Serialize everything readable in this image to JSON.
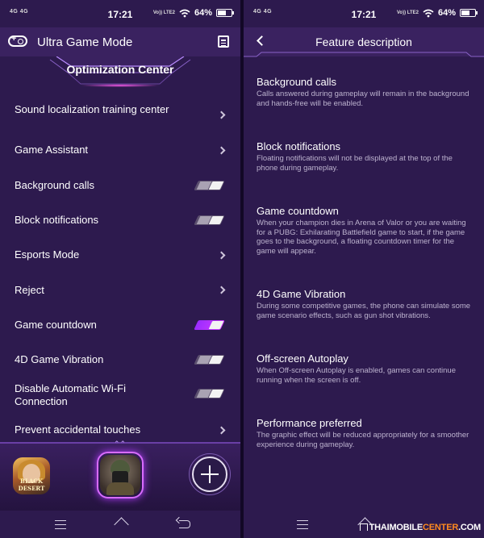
{
  "status_bar": {
    "signal": "4G 4G",
    "time": "17:21",
    "volte": "Vo)) LTE2",
    "battery": "64%",
    "battery_level": 0.64
  },
  "left": {
    "app_title": "Ultra Game Mode",
    "section_title": "Optimization Center",
    "items": [
      {
        "label": "Sound localization training center",
        "control": "chevron"
      },
      {
        "label": "Game Assistant",
        "control": "chevron"
      },
      {
        "label": "Background calls",
        "control": "toggle",
        "on": false
      },
      {
        "label": "Block notifications",
        "control": "toggle",
        "on": false
      },
      {
        "label": "Esports Mode",
        "control": "chevron"
      },
      {
        "label": "Reject",
        "control": "chevron"
      },
      {
        "label": "Game countdown",
        "control": "toggle",
        "on": true
      },
      {
        "label": "4D Game Vibration",
        "control": "toggle",
        "on": false
      },
      {
        "label": "Disable Automatic Wi-Fi Connection",
        "control": "toggle",
        "on": false
      },
      {
        "label": "Prevent accidental touches",
        "control": "chevron"
      }
    ],
    "dock": {
      "game1_tag": "BLACK DESERT",
      "game1_icon": "black-desert-icon",
      "game2_icon": "pubg-icon",
      "add_icon": "plus-icon"
    }
  },
  "right": {
    "title": "Feature description",
    "features": [
      {
        "title": "Background calls",
        "desc": "Calls answered during gameplay will remain in the background and hands-free will be enabled."
      },
      {
        "title": "Block notifications",
        "desc": "Floating notifications will not be displayed at the top of the phone during gameplay."
      },
      {
        "title": "Game countdown",
        "desc": "When your champion dies in Arena of Valor or you are waiting for a PUBG: Exhilarating Battlefield game to start, if the game goes to the background, a floating countdown timer for the game will appear."
      },
      {
        "title": "4D Game Vibration",
        "desc": "During some competitive games, the phone can simulate some game scenario effects, such as gun shot vibrations."
      },
      {
        "title": "Off-screen Autoplay",
        "desc": "When Off-screen Autoplay is enabled, games can continue running when the screen is off."
      },
      {
        "title": "Performance preferred",
        "desc": "The graphic effect will be reduced appropriately for a smoother experience during gameplay."
      }
    ]
  },
  "watermark": {
    "part1": "THAIMOBILE",
    "part2": "CENTER",
    "part3": ".COM"
  },
  "colors": {
    "background": "#2d1a4e",
    "header": "#3a2260",
    "accent": "#b43bff",
    "toggle_on": "#9a2cff",
    "desc_text": "#bdb3cf"
  }
}
